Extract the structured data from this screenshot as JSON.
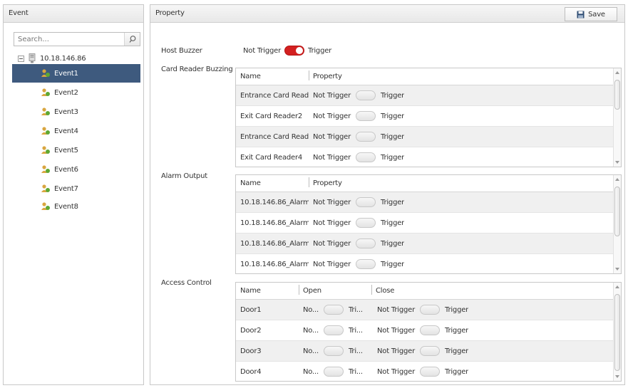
{
  "left": {
    "title": "Event",
    "search_placeholder": "Search...",
    "root_label": "10.18.146.86",
    "events": [
      "Event1",
      "Event2",
      "Event3",
      "Event4",
      "Event5",
      "Event6",
      "Event7",
      "Event8"
    ]
  },
  "right": {
    "title": "Property",
    "save_label": "Save",
    "host_buzzer": {
      "label": "Host Buzzer",
      "off": "Not Trigger",
      "on": "Trigger"
    },
    "card_reader": {
      "label": "Card Reader Buzzing",
      "col_name": "Name",
      "col_property": "Property",
      "rows": [
        {
          "name": "Entrance Card Read...",
          "off": "Not Trigger",
          "on": "Trigger"
        },
        {
          "name": "Exit Card Reader2",
          "off": "Not Trigger",
          "on": "Trigger"
        },
        {
          "name": "Entrance Card Read...",
          "off": "Not Trigger",
          "on": "Trigger"
        },
        {
          "name": "Exit Card Reader4",
          "off": "Not Trigger",
          "on": "Trigger"
        }
      ]
    },
    "alarm_output": {
      "label": "Alarm Output",
      "col_name": "Name",
      "col_property": "Property",
      "rows": [
        {
          "name": "10.18.146.86_Alarm ...",
          "off": "Not Trigger",
          "on": "Trigger"
        },
        {
          "name": "10.18.146.86_Alarm ...",
          "off": "Not Trigger",
          "on": "Trigger"
        },
        {
          "name": "10.18.146.86_Alarm ...",
          "off": "Not Trigger",
          "on": "Trigger"
        },
        {
          "name": "10.18.146.86_Alarm ...",
          "off": "Not Trigger",
          "on": "Trigger"
        }
      ]
    },
    "access_control": {
      "label": "Access Control",
      "col_name": "Name",
      "col_open": "Open",
      "col_close": "Close",
      "rows": [
        {
          "name": "Door1",
          "open_off": "No...",
          "open_on": "Tri...",
          "close_off": "Not Trigger",
          "close_on": "Trigger"
        },
        {
          "name": "Door2",
          "open_off": "No...",
          "open_on": "Tri...",
          "close_off": "Not Trigger",
          "close_on": "Trigger"
        },
        {
          "name": "Door3",
          "open_off": "No...",
          "open_on": "Tri...",
          "close_off": "Not Trigger",
          "close_on": "Trigger"
        },
        {
          "name": "Door4",
          "open_off": "No...",
          "open_on": "Tri...",
          "close_off": "Not Trigger",
          "close_on": "Trigger"
        }
      ]
    }
  },
  "colors": {
    "selected_bg": "#3e5a7e",
    "toggle_on": "#d32020"
  },
  "icons": [
    "search-icon",
    "device-icon",
    "event-icon",
    "save-icon"
  ]
}
